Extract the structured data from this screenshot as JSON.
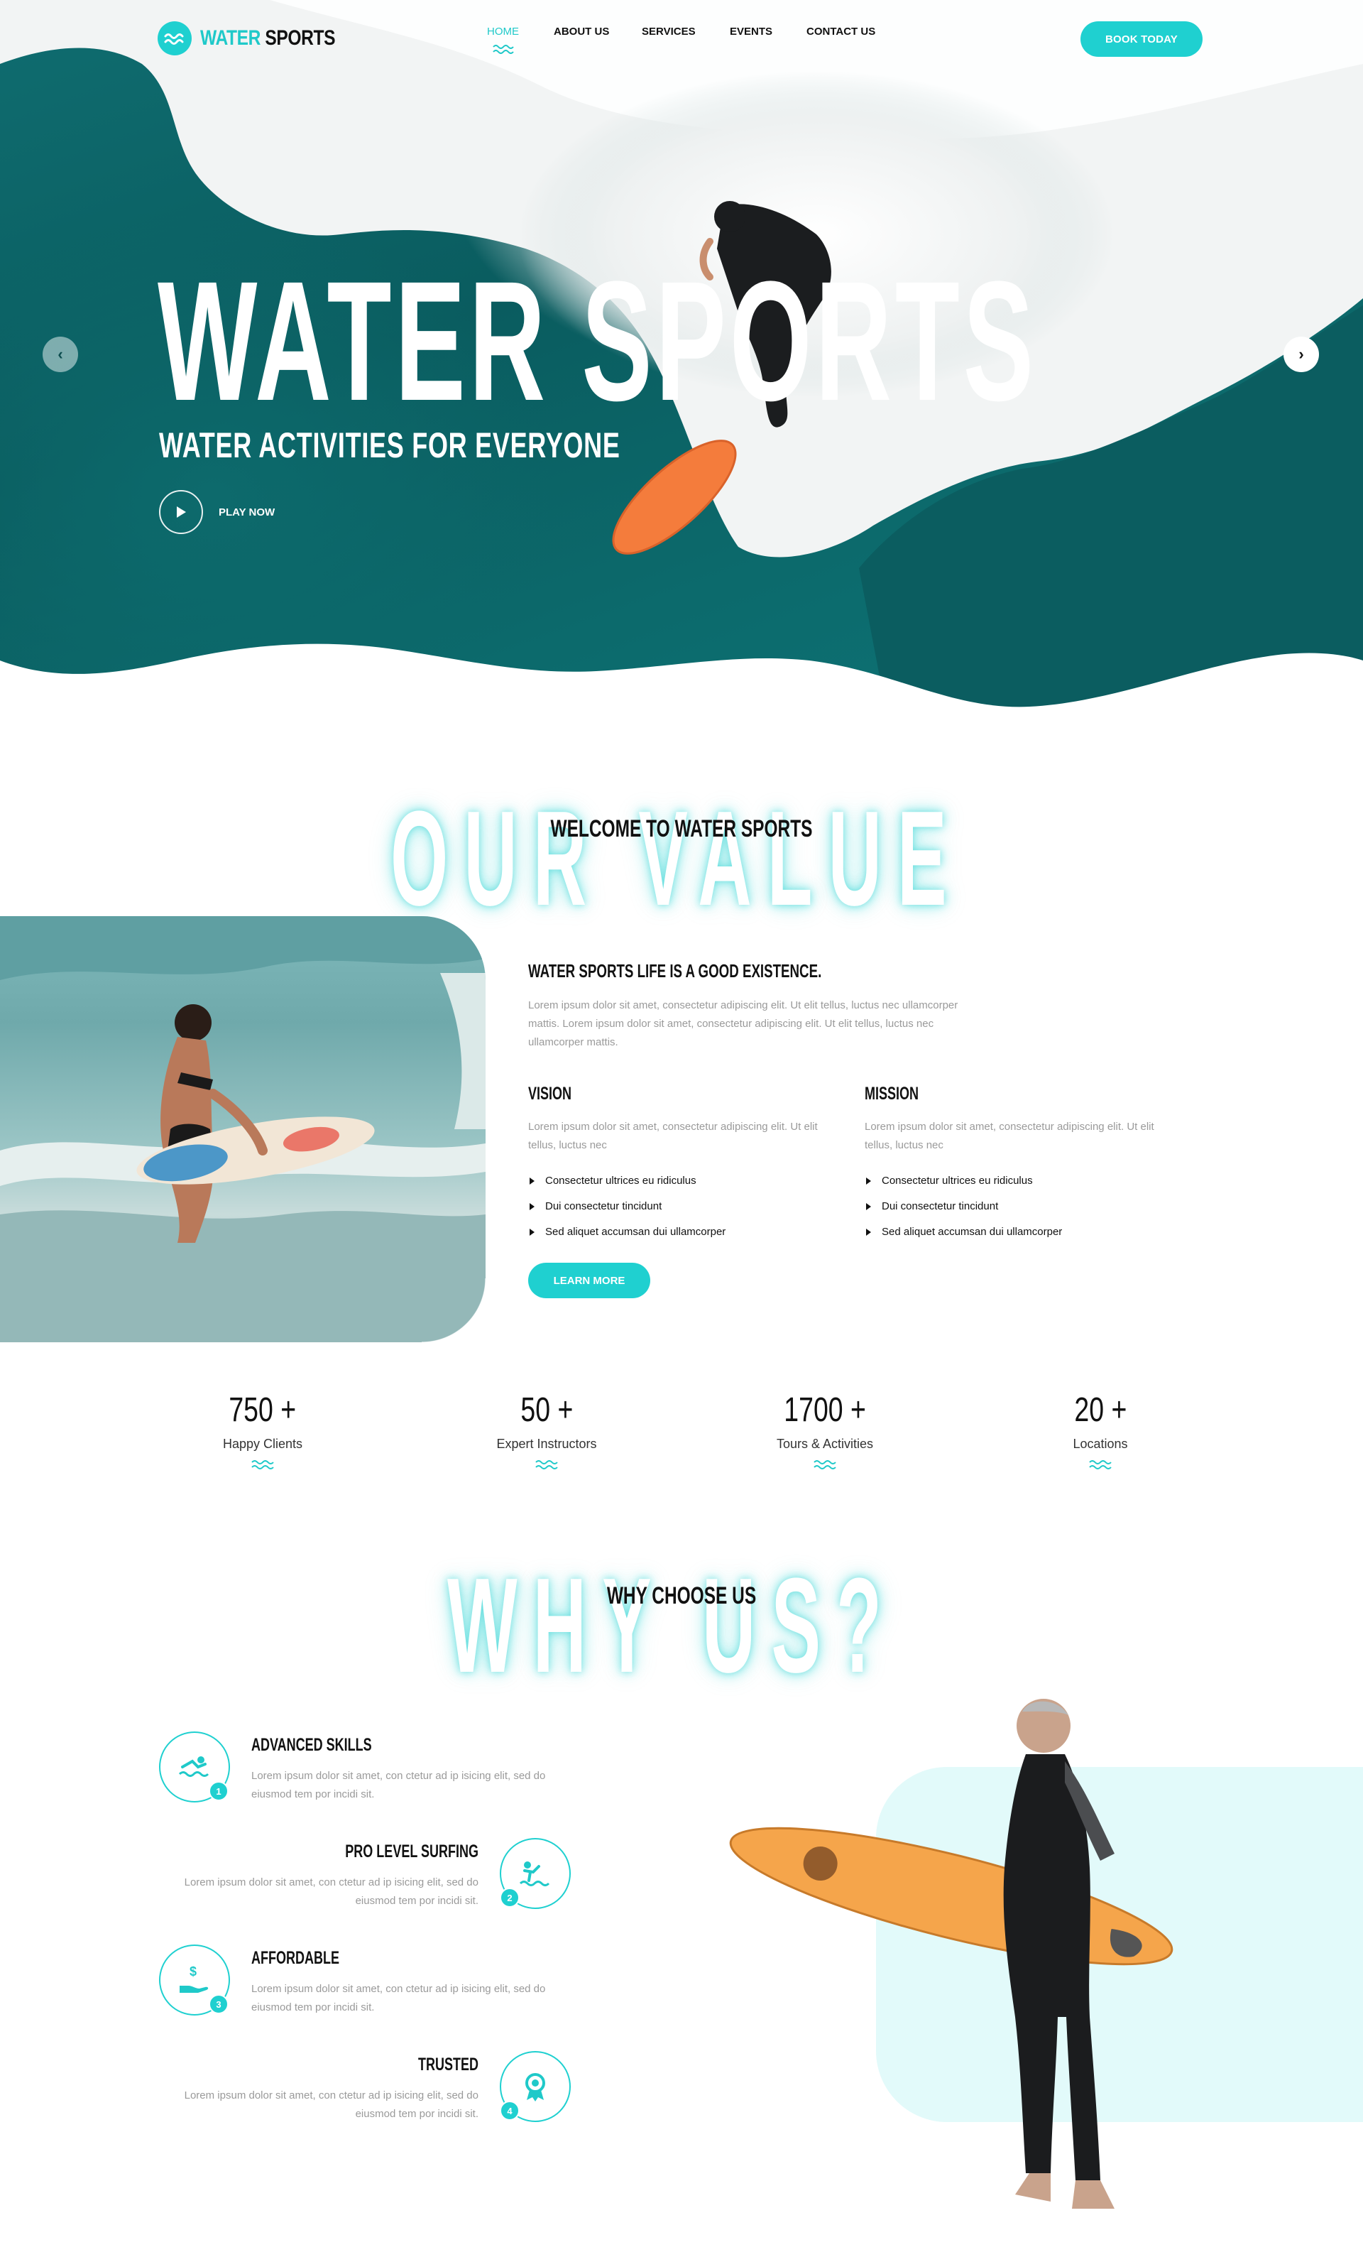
{
  "brand": {
    "name_accent": "WATER",
    "name_dark": "SPORTS",
    "accent_color": "#1fd0d0"
  },
  "nav": {
    "items": [
      {
        "label": "HOME",
        "active": true
      },
      {
        "label": "ABOUT US",
        "active": false
      },
      {
        "label": "SERVICES",
        "active": false
      },
      {
        "label": "EVENTS",
        "active": false
      },
      {
        "label": "CONTACT US",
        "active": false
      }
    ],
    "cta": "BOOK TODAY"
  },
  "hero": {
    "title": "WATER SPORTS",
    "subtitle": "WATER ACTIVITIES FOR EVERYONE",
    "play_label": "PLAY NOW",
    "prev_icon": "chevron-left-icon",
    "next_icon": "chevron-right-icon"
  },
  "welcome": {
    "ghost_text": "OUR VALUE",
    "title": "WELCOME TO WATER SPORTS",
    "heading": "WATER SPORTS LIFE IS A GOOD EXISTENCE.",
    "paragraph": "Lorem ipsum dolor sit amet, consectetur adipiscing elit. Ut elit tellus, luctus nec ullamcorper mattis. Lorem ipsum dolor sit amet, consectetur adipiscing elit. Ut elit tellus, luctus nec ullamcorper mattis.",
    "vision": {
      "title": "VISION",
      "text": "Lorem ipsum dolor sit amet, consectetur adipiscing elit. Ut elit tellus, luctus nec",
      "bullets": [
        "Consectetur ultrices eu ridiculus",
        "Dui consectetur tincidunt",
        "Sed aliquet accumsan dui ullamcorper"
      ]
    },
    "mission": {
      "title": "MISSION",
      "text": "Lorem ipsum dolor sit amet, consectetur adipiscing elit. Ut elit tellus, luctus nec",
      "bullets": [
        "Consectetur ultrices eu ridiculus",
        "Dui consectetur tincidunt",
        "Sed aliquet accumsan dui ullamcorper"
      ]
    },
    "button": "LEARN MORE"
  },
  "stats": [
    {
      "number": "750 +",
      "label": "Happy Clients"
    },
    {
      "number": "50 +",
      "label": "Expert Instructors"
    },
    {
      "number": "1700 +",
      "label": "Tours & Activities"
    },
    {
      "number": "20 +",
      "label": "Locations"
    }
  ],
  "why": {
    "ghost_text": "WHY US?",
    "title": "WHY CHOOSE US",
    "features": [
      {
        "title": "ADVANCED SKILLS",
        "text": "Lorem ipsum dolor sit amet, con ctetur ad ip isicing elit, sed do eiusmod tem por incidi sit.",
        "badge": "1",
        "icon": "swimmer-icon"
      },
      {
        "title": "PRO LEVEL SURFING",
        "text": "Lorem ipsum dolor sit amet, con ctetur ad ip isicing elit, sed do eiusmod tem por incidi sit.",
        "badge": "2",
        "icon": "surfing-icon"
      },
      {
        "title": "AFFORDABLE",
        "text": "Lorem ipsum dolor sit amet, con ctetur ad ip isicing elit, sed do eiusmod tem por incidi sit.",
        "badge": "3",
        "icon": "money-hand-icon"
      },
      {
        "title": "TRUSTED",
        "text": "Lorem ipsum dolor sit amet, con ctetur ad ip isicing elit, sed do eiusmod tem por incidi sit.",
        "badge": "4",
        "icon": "award-icon"
      }
    ]
  }
}
